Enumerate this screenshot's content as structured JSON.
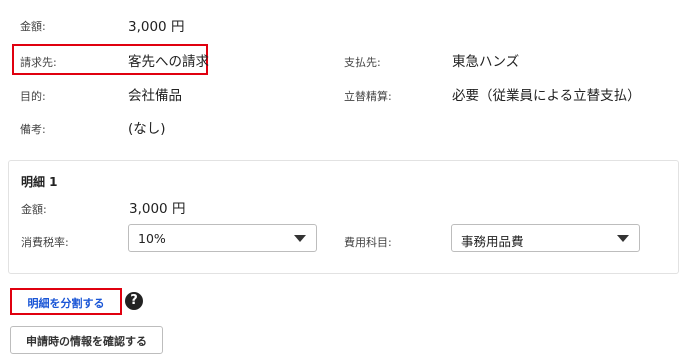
{
  "summary": {
    "amount_label": "金額:",
    "amount_value": "3,000 円",
    "billing_to_label": "請求先:",
    "billing_to_value": "客先への請求",
    "payee_label": "支払先:",
    "payee_value": "東急ハンズ",
    "purpose_label": "目的:",
    "purpose_value": "会社備品",
    "reimbursement_label": "立替精算:",
    "reimbursement_value": "必要（従業員による立替支払）",
    "remarks_label": "備考:",
    "remarks_value": "(なし)"
  },
  "detail": {
    "title": "明細 1",
    "amount_label": "金額:",
    "amount_value": "3,000 円",
    "tax_rate_label": "消費税率:",
    "tax_rate_value": "10%",
    "account_label": "費用科目:",
    "account_value": "事務用品費"
  },
  "actions": {
    "split_label": "明細を分割する",
    "help_icon": "question-circle-icon",
    "confirm_label": "申請時の情報を確認する"
  },
  "colors": {
    "highlight": "#e0000f",
    "link": "#1a56d6"
  }
}
